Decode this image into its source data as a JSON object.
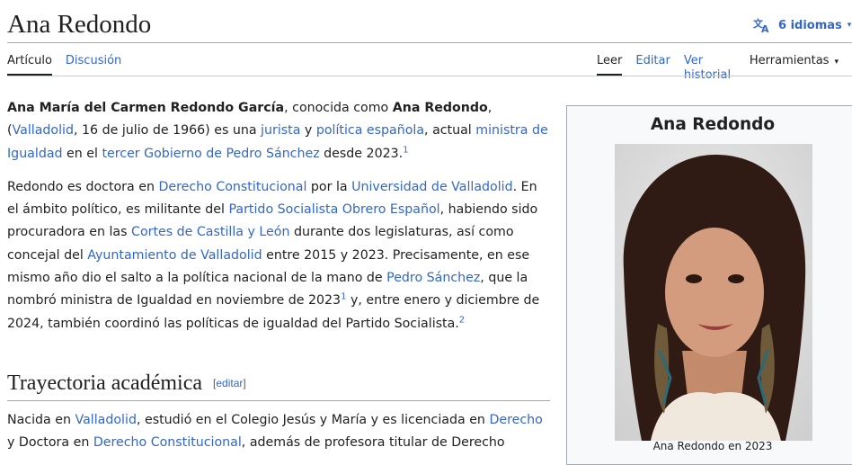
{
  "article": {
    "title": "Ana Redondo",
    "languages_label": "6 idiomas"
  },
  "tabs": {
    "article": "Artículo",
    "discussion": "Discusión",
    "read": "Leer",
    "edit": "Editar",
    "history": "Ver historial",
    "tools": "Herramientas"
  },
  "intro": {
    "p1": {
      "full_name": "Ana María del Carmen Redondo García",
      "t1": ", conocida como ",
      "short_name": "Ana Redondo",
      "t2": ", (",
      "l_valladolid": "Valladolid",
      "t3": ", 16 de julio de 1966) es una ",
      "l_jurista": "jurista",
      "t4": " y ",
      "l_politica": "política española",
      "t5": ", actual ",
      "l_ministra": "ministra de Igualdad",
      "t6": " en el ",
      "l_gobierno": "tercer Gobierno de Pedro Sánchez",
      "t7": " desde 2023.",
      "ref1": "1"
    },
    "p2": {
      "t1": "Redondo es doctora en ",
      "l_derecho_const": "Derecho Constitucional",
      "t2": " por la ",
      "l_uva": "Universidad de Valladolid",
      "t3": ". En el ámbito político, es militante del ",
      "l_psoe": "Partido Socialista Obrero Español",
      "t4": ", habiendo sido procuradora en las ",
      "l_cortes": "Cortes de Castilla y León",
      "t5": " durante dos legislaturas, así como concejal del ",
      "l_ayto": "Ayuntamiento de Valladolid",
      "t6": " entre 2015 y 2023. Precisamente, en ese mismo año dio el salto a la política nacional de la mano de ",
      "l_sanchez": "Pedro Sánchez",
      "t7": ", que la nombró ministra de Igualdad en noviembre de 2023",
      "ref1": "1",
      "t8": "  y, entre enero y diciembre de 2024, también coordinó las políticas de igualdad del Partido Socialista.",
      "ref2": "2"
    }
  },
  "section1": {
    "heading": "Trayectoria académica",
    "edit_open": "[",
    "edit_label": "editar",
    "edit_close": "]",
    "p1": {
      "t1": "Nacida en ",
      "l_valladolid": "Valladolid",
      "t2": ", estudió en el Colegio Jesús y María y es licenciada en ",
      "l_derecho": "Derecho",
      "t3": " y Doctora en ",
      "l_derecho_const": "Derecho Constitucional",
      "t4": ", además de profesora titular de Derecho"
    }
  },
  "infobox": {
    "title": "Ana Redondo",
    "caption": "Ana Redondo en 2023"
  },
  "colors": {
    "link": "#3366cc",
    "text": "#202122",
    "infobox_bg": "#f8f9fa",
    "border": "#a2a9b1"
  }
}
